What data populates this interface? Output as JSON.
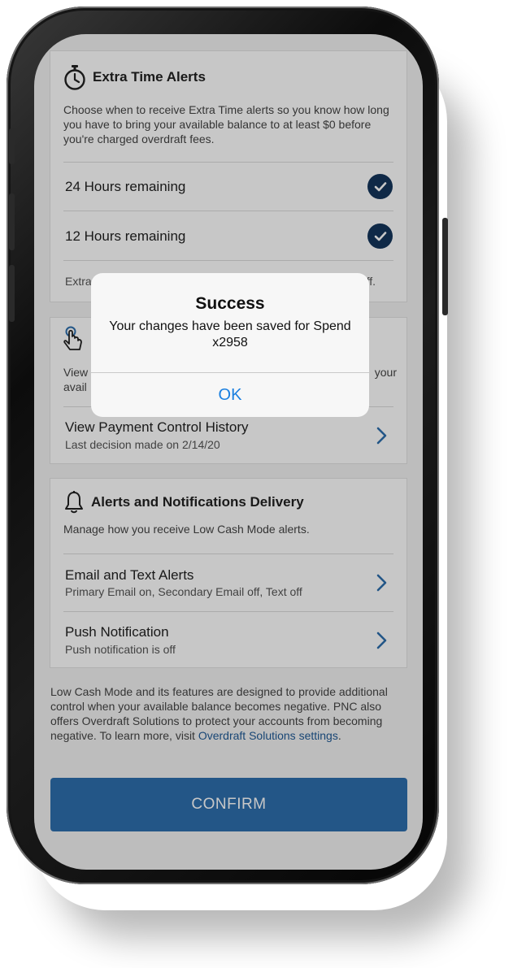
{
  "extra_time": {
    "title": "Extra Time Alerts",
    "description": "Choose when to receive Extra Time alerts so you know how long you have to bring your available balance to at least $0 before you're charged overdraft fees.",
    "options": [
      {
        "label": "24 Hours remaining",
        "checked": true
      },
      {
        "label": "12 Hours remaining",
        "checked": true
      }
    ],
    "note_start": "Extra",
    "note_end": "ff."
  },
  "payment_control": {
    "desc_start": "View",
    "desc_start_2": "avail",
    "desc_end": "your",
    "history_title": "View Payment Control History",
    "history_sub": "Last decision made on 2/14/20"
  },
  "alerts_delivery": {
    "title": "Alerts and Notifications Delivery",
    "description": "Manage how you receive Low Cash Mode alerts.",
    "items": [
      {
        "title": "Email and Text Alerts",
        "subtitle": "Primary Email on, Secondary Email off, Text off"
      },
      {
        "title": "Push Notification",
        "subtitle": "Push notification is off"
      }
    ]
  },
  "footnote": {
    "text": "Low Cash Mode and its features are designed to provide additional control when your available balance becomes negative. PNC also offers Overdraft Solutions to protect your accounts from becoming negative. To learn more, visit ",
    "link": "Overdraft Solutions settings",
    "end": "."
  },
  "confirm_label": "CONFIRM",
  "dialog": {
    "title": "Success",
    "message": "Your changes have been saved for Spend x2958",
    "ok_label": "OK"
  },
  "colors": {
    "primary": "#2e6fad",
    "check": "#14355c",
    "link": "#1f5a96",
    "ios_blue": "#1a7fe0"
  },
  "icons": [
    "stopwatch-icon",
    "hand-pointer-icon",
    "bell-icon",
    "check-icon",
    "chevron-right-icon"
  ]
}
